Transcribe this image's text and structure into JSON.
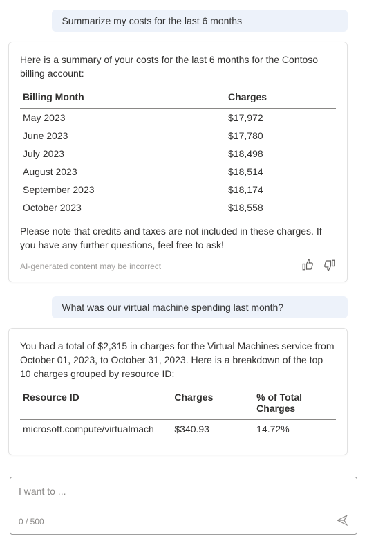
{
  "messages": {
    "user1": "Summarize my costs for the last 6 months",
    "user2": "What was our virtual machine spending last month?"
  },
  "response1": {
    "intro": "Here is a summary of your costs for the last 6 months for the Contoso billing account:",
    "headers": {
      "month": "Billing Month",
      "charges": "Charges"
    },
    "rows": [
      {
        "month": "May 2023",
        "charges": "$17,972"
      },
      {
        "month": "June 2023",
        "charges": "$17,780"
      },
      {
        "month": "July 2023",
        "charges": "$18,498"
      },
      {
        "month": "August 2023",
        "charges": "$18,514"
      },
      {
        "month": "September 2023",
        "charges": "$18,174"
      },
      {
        "month": "October 2023",
        "charges": "$18,558"
      }
    ],
    "footnote": "Please note that credits and taxes are not included in these charges. If you have any further questions, feel free to ask!",
    "disclaimer": "AI-generated content may be incorrect"
  },
  "response2": {
    "intro": "You had a total of $2,315 in charges for the Virtual Machines service from October 01, 2023, to October 31, 2023. Here is a breakdown of the top 10 charges grouped by resource ID:",
    "headers": {
      "resource": "Resource ID",
      "charges": "Charges",
      "pct": "% of Total Charges"
    },
    "rows": [
      {
        "resource": "microsoft.compute/virtualmach",
        "charges": "$340.93",
        "pct": "14.72%"
      }
    ]
  },
  "input": {
    "placeholder": "I want to ...",
    "counter": "0 / 500"
  }
}
